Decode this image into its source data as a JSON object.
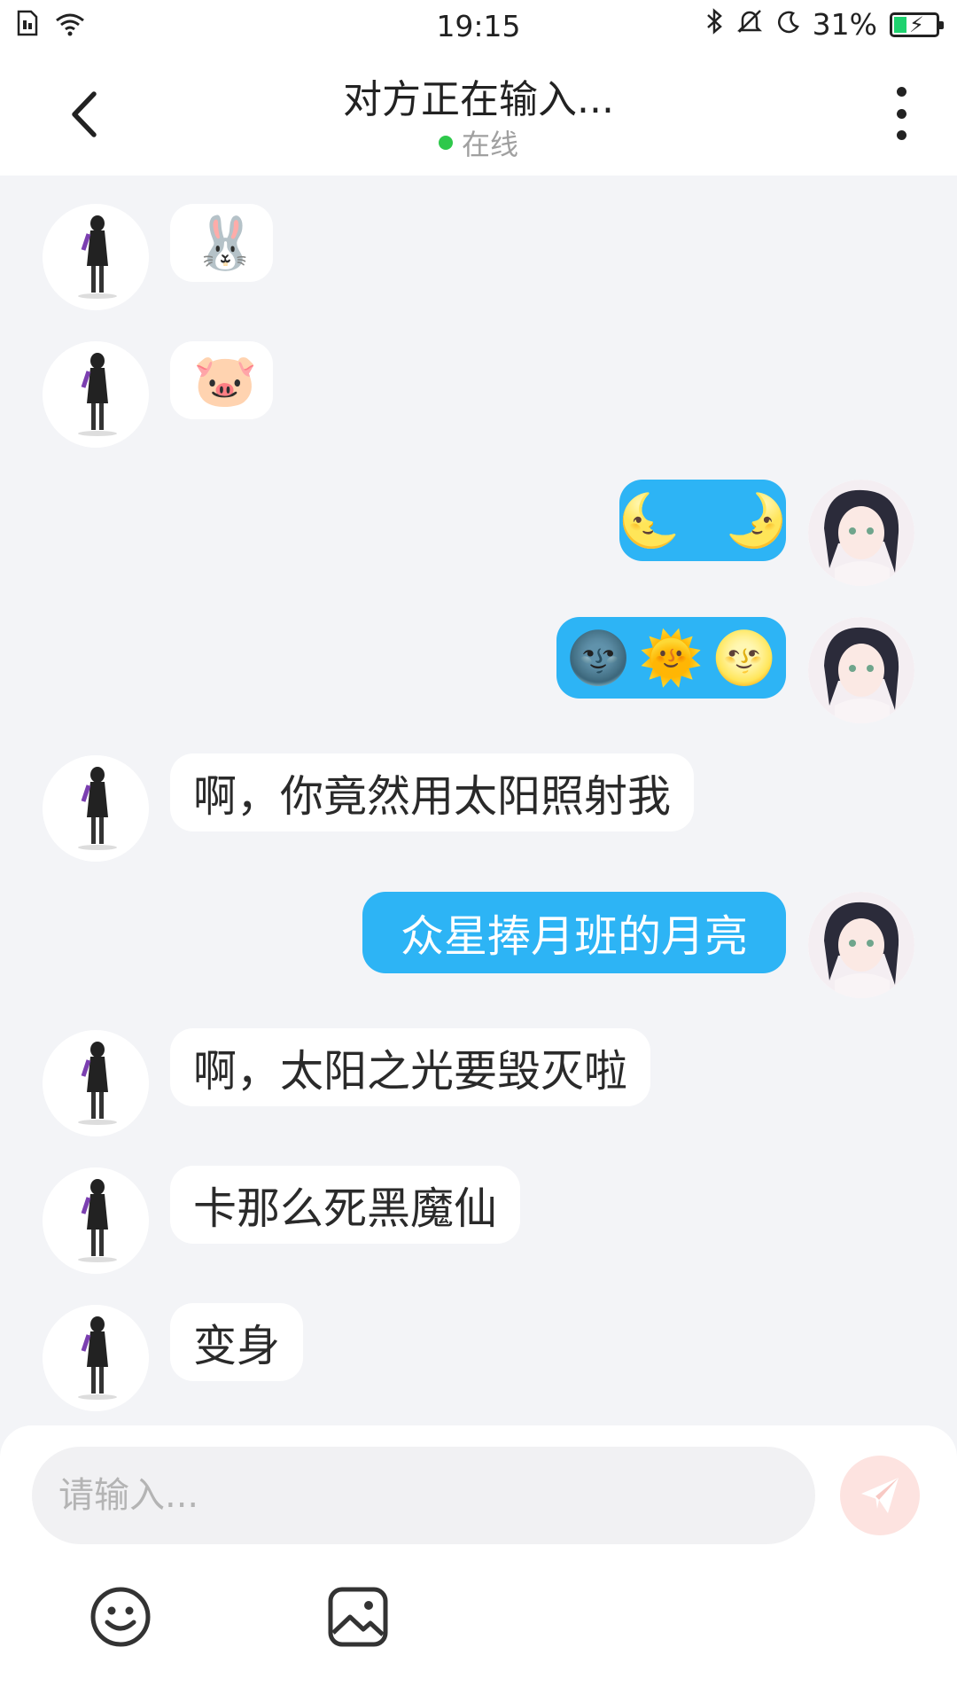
{
  "status_bar": {
    "time": "19:15",
    "battery_percent": "31%",
    "battery_level": 0.31,
    "icons": [
      "sim-icon",
      "wifi-icon",
      "bluetooth-icon",
      "bell-muted-icon",
      "moon-icon",
      "battery-charging-icon"
    ]
  },
  "header": {
    "title": "对方正在输入...",
    "status": "在线",
    "status_color": "#2ec84b"
  },
  "messages": [
    {
      "side": "left",
      "text": "🐰",
      "kind": "emoji"
    },
    {
      "side": "left",
      "text": "🐷",
      "kind": "emoji"
    },
    {
      "side": "right",
      "parts": [
        "🌜",
        "🌛"
      ],
      "kind": "emoji"
    },
    {
      "side": "right",
      "parts": [
        "🌚",
        "🌞",
        "🌝"
      ],
      "kind": "emoji"
    },
    {
      "side": "left",
      "text": "啊，你竟然用太阳照射我",
      "kind": "text"
    },
    {
      "side": "right",
      "text": "众星捧月班的月亮",
      "kind": "text"
    },
    {
      "side": "left",
      "text": "啊，太阳之光要毁灭啦",
      "kind": "text"
    },
    {
      "side": "left",
      "text": "卡那么死黑魔仙",
      "kind": "text"
    },
    {
      "side": "left",
      "text": "变身",
      "kind": "text"
    }
  ],
  "composer": {
    "placeholder": "请输入...",
    "value": "",
    "send_icon": "send-paper-plane-icon",
    "tools": [
      "emoji-smile-icon",
      "image-gallery-icon"
    ]
  },
  "colors": {
    "outgoing_bubble": "#2db4f5",
    "incoming_bubble": "#ffffff",
    "chat_background": "#f3f4f7",
    "send_button": "#fde3e0"
  }
}
